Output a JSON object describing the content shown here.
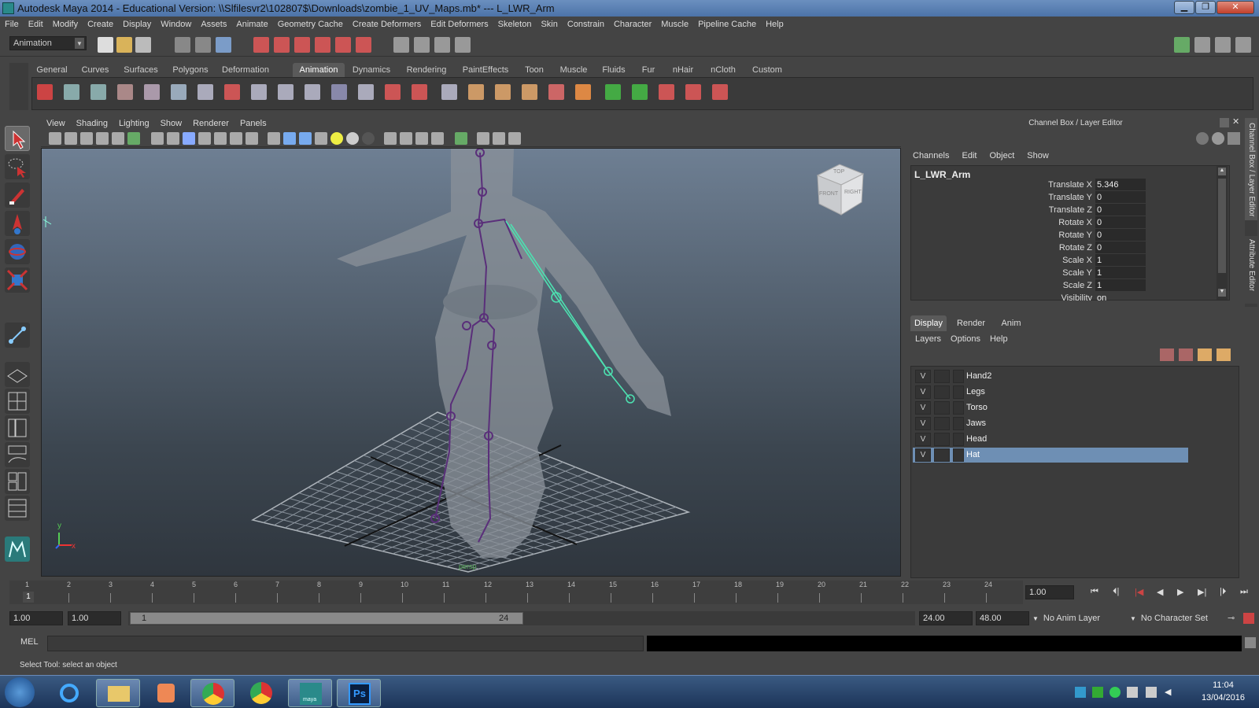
{
  "window": {
    "title": "Autodesk Maya 2014 - Educational Version: \\\\Slfilesvr2\\102807$\\Downloads\\zombie_1_UV_Maps.mb*  ---  L_LWR_Arm"
  },
  "menubar": [
    "File",
    "Edit",
    "Modify",
    "Create",
    "Display",
    "Window",
    "Assets",
    "Animate",
    "Geometry Cache",
    "Create Deformers",
    "Edit Deformers",
    "Skeleton",
    "Skin",
    "Constrain",
    "Character",
    "Muscle",
    "Pipeline Cache",
    "Help"
  ],
  "statusline": {
    "mode": "Animation"
  },
  "shelf_tabs": [
    "General",
    "Curves",
    "Surfaces",
    "Polygons",
    "Deformation",
    "Animation",
    "Dynamics",
    "Rendering",
    "PaintEffects",
    "Toon",
    "Muscle",
    "Fluids",
    "Fur",
    "nHair",
    "nCloth",
    "Custom"
  ],
  "shelf_active": "Animation",
  "viewport": {
    "menu": [
      "View",
      "Shading",
      "Lighting",
      "Show",
      "Renderer",
      "Panels"
    ],
    "viewcube": {
      "top": "TOP",
      "front": "FRONT",
      "right": "RIGHT"
    },
    "axis": {
      "y": "y",
      "x": "x"
    },
    "camera_label": "persp"
  },
  "channel_box": {
    "header": "Channel Box / Layer Editor",
    "menu": [
      "Channels",
      "Edit",
      "Object",
      "Show"
    ],
    "object": "L_LWR_Arm",
    "channels": [
      {
        "label": "Translate X",
        "value": "5.346"
      },
      {
        "label": "Translate Y",
        "value": "0"
      },
      {
        "label": "Translate Z",
        "value": "0"
      },
      {
        "label": "Rotate X",
        "value": "0"
      },
      {
        "label": "Rotate Y",
        "value": "0"
      },
      {
        "label": "Rotate Z",
        "value": "0"
      },
      {
        "label": "Scale X",
        "value": "1"
      },
      {
        "label": "Scale Y",
        "value": "1"
      },
      {
        "label": "Scale Z",
        "value": "1"
      },
      {
        "label": "Visibility",
        "value": "on"
      }
    ]
  },
  "side_tabs": {
    "channel_box": "Channel Box / Layer Editor",
    "attribute_editor": "Attribute Editor"
  },
  "layer_editor": {
    "tabs": [
      "Display",
      "Render",
      "Anim"
    ],
    "active_tab": "Display",
    "menu": [
      "Layers",
      "Options",
      "Help"
    ],
    "layers": [
      {
        "v": "V",
        "name": "Hand2",
        "selected": false
      },
      {
        "v": "V",
        "name": "Legs",
        "selected": false
      },
      {
        "v": "V",
        "name": "Torso",
        "selected": false
      },
      {
        "v": "V",
        "name": "Jaws",
        "selected": false
      },
      {
        "v": "V",
        "name": "Head",
        "selected": false
      },
      {
        "v": "V",
        "name": "Hat",
        "selected": true
      }
    ]
  },
  "time_slider": {
    "ticks": [
      "1",
      "2",
      "3",
      "4",
      "5",
      "6",
      "7",
      "8",
      "9",
      "10",
      "11",
      "12",
      "13",
      "14",
      "15",
      "16",
      "17",
      "18",
      "19",
      "20",
      "21",
      "22",
      "23",
      "24"
    ],
    "current_frame": "1",
    "current_time_field": "1.00"
  },
  "range_slider": {
    "start_time": "1.00",
    "playback_start": "1.00",
    "range_start_label": "1",
    "range_end_label": "24",
    "playback_end": "24.00",
    "end_time": "48.00",
    "anim_layer": "No Anim Layer",
    "character_set": "No Character Set"
  },
  "command_line": {
    "label": "MEL",
    "value": ""
  },
  "help_line": "Select Tool: select an object",
  "taskbar": {
    "time": "11:04",
    "date": "13/04/2016",
    "maya_label": "maya"
  }
}
